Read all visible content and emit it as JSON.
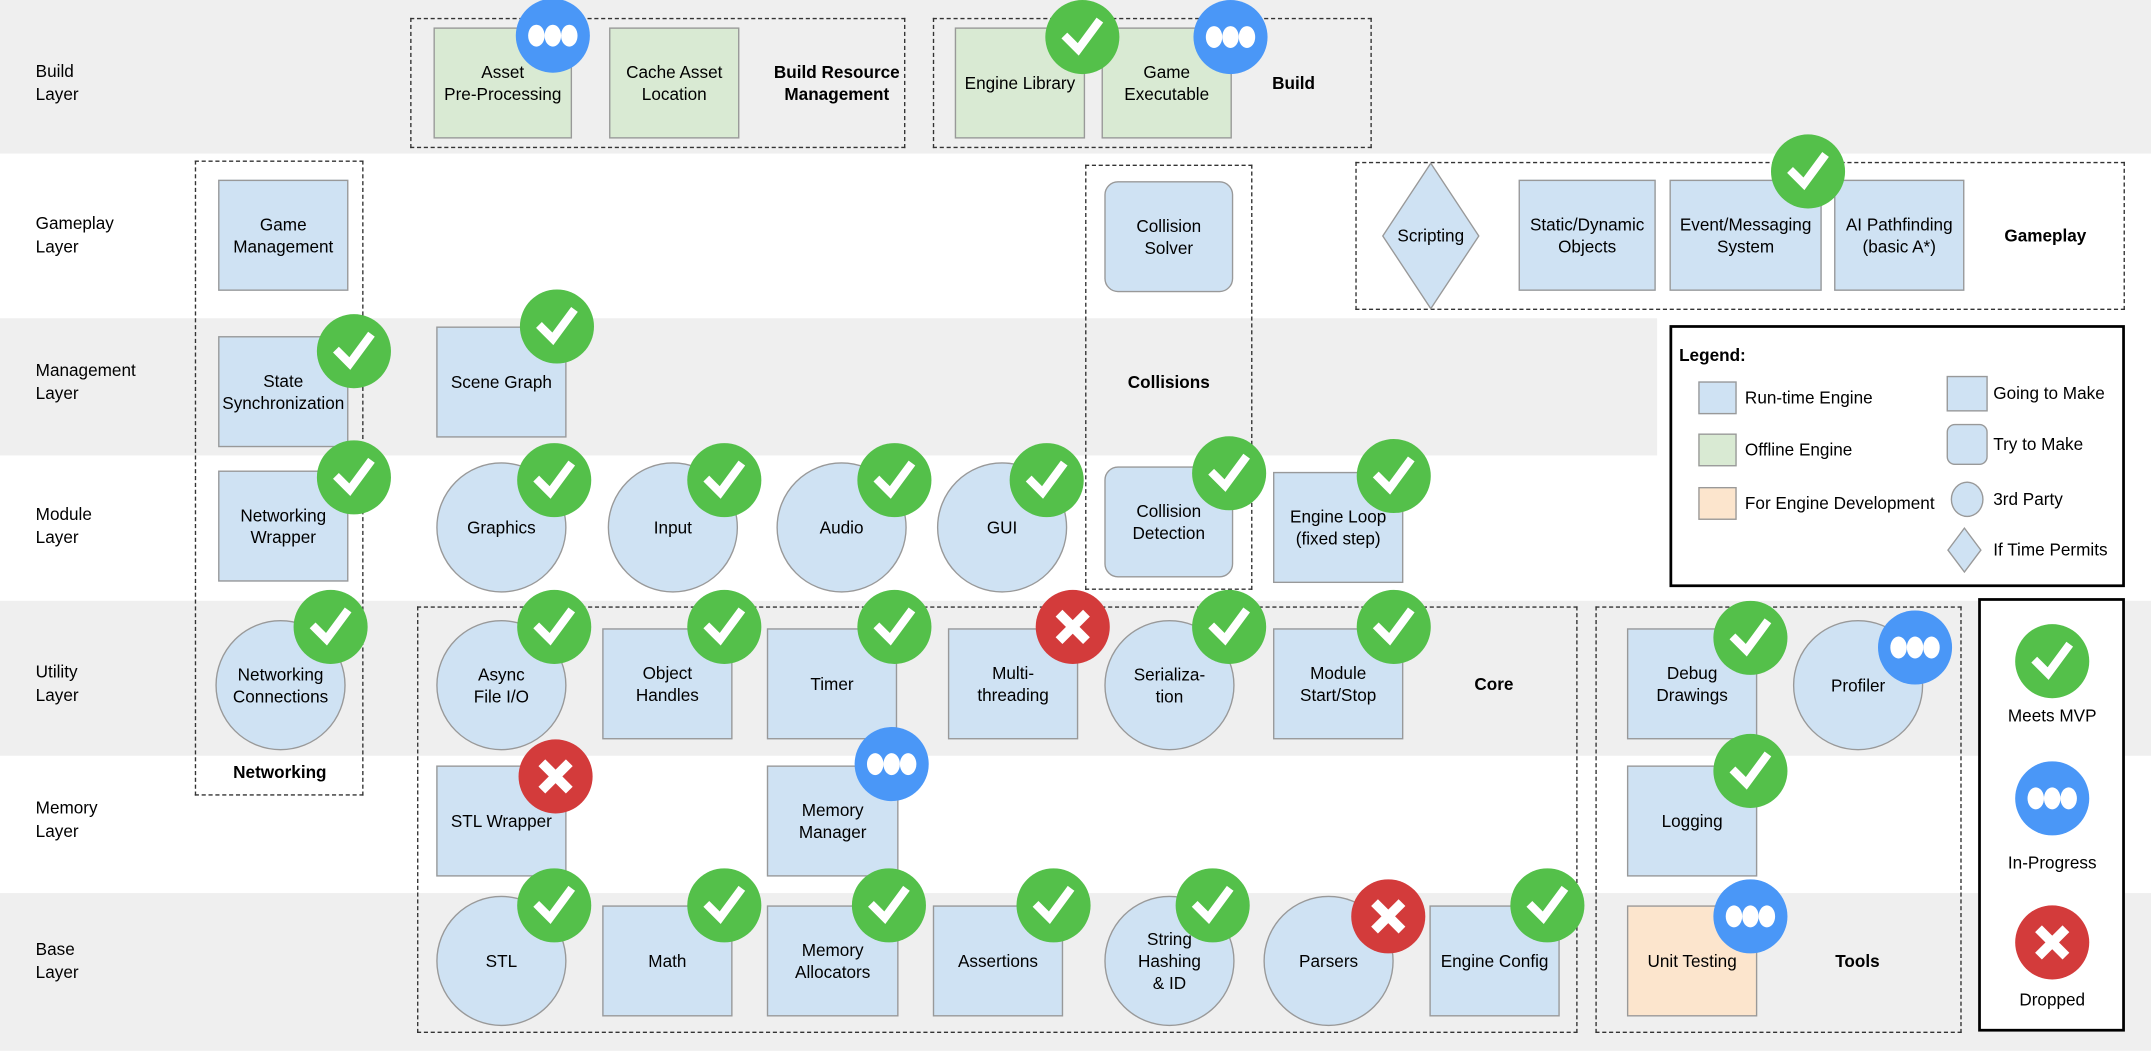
{
  "colors": {
    "runtime": "#cfe2f3",
    "offline": "#d9ead3",
    "dev": "#fce5cd",
    "done": "#54c04a",
    "in_progress": "#4a97f7",
    "dropped": "#d33b3b",
    "band": "#efefef"
  },
  "layers": [
    {
      "label": "Build\nLayer",
      "shade": true
    },
    {
      "label": "Gameplay\nLayer",
      "shade": false
    },
    {
      "label": "Management\nLayer",
      "shade": true
    },
    {
      "label": "Module\nLayer",
      "shade": false
    },
    {
      "label": "Utility\nLayer",
      "shade": true
    },
    {
      "label": "Memory\nLayer",
      "shade": false
    },
    {
      "label": "Base\nLayer",
      "shade": true
    }
  ],
  "groups": [
    {
      "label": "Build Resource\nManagement"
    },
    {
      "label": "Build"
    },
    {
      "label": "Networking"
    },
    {
      "label": "Collisions"
    },
    {
      "label": "Gameplay"
    },
    {
      "label": "Core"
    },
    {
      "label": "Tools"
    }
  ],
  "nodes": [
    {
      "label": "Asset\nPre-Processing",
      "kind": "offline",
      "shape": "square",
      "status": "in-progress"
    },
    {
      "label": "Cache Asset\nLocation",
      "kind": "offline",
      "shape": "square",
      "status": null
    },
    {
      "label": "Engine Library",
      "kind": "offline",
      "shape": "square",
      "status": "done"
    },
    {
      "label": "Game\nExecutable",
      "kind": "offline",
      "shape": "square",
      "status": "in-progress"
    },
    {
      "label": "Game\nManagement",
      "kind": "runtime",
      "shape": "square",
      "status": null
    },
    {
      "label": "Collision\nSolver",
      "kind": "runtime",
      "shape": "rounded",
      "status": null
    },
    {
      "label": "Scripting",
      "kind": "runtime",
      "shape": "diamond",
      "status": null
    },
    {
      "label": "Static/Dynamic\nObjects",
      "kind": "runtime",
      "shape": "square",
      "status": null
    },
    {
      "label": "Event/Messaging\nSystem",
      "kind": "runtime",
      "shape": "square",
      "status": "done"
    },
    {
      "label": "AI Pathfinding\n(basic A*)",
      "kind": "runtime",
      "shape": "square",
      "status": null
    },
    {
      "label": "State\nSynchronization",
      "kind": "runtime",
      "shape": "square",
      "status": "done"
    },
    {
      "label": "Scene Graph",
      "kind": "runtime",
      "shape": "square",
      "status": "done"
    },
    {
      "label": "Networking\nWrapper",
      "kind": "runtime",
      "shape": "square",
      "status": "done"
    },
    {
      "label": "Graphics",
      "kind": "runtime",
      "shape": "circle",
      "status": "done"
    },
    {
      "label": "Input",
      "kind": "runtime",
      "shape": "circle",
      "status": "done"
    },
    {
      "label": "Audio",
      "kind": "runtime",
      "shape": "circle",
      "status": "done"
    },
    {
      "label": "GUI",
      "kind": "runtime",
      "shape": "circle",
      "status": "done"
    },
    {
      "label": "Collision\nDetection",
      "kind": "runtime",
      "shape": "rounded",
      "status": "done"
    },
    {
      "label": "Engine Loop\n(fixed step)",
      "kind": "runtime",
      "shape": "square",
      "status": "done"
    },
    {
      "label": "Networking\nConnections",
      "kind": "runtime",
      "shape": "circle",
      "status": "done"
    },
    {
      "label": "Async\nFile I/O",
      "kind": "runtime",
      "shape": "circle",
      "status": "done"
    },
    {
      "label": "Object\nHandles",
      "kind": "runtime",
      "shape": "square",
      "status": "done"
    },
    {
      "label": "Timer",
      "kind": "runtime",
      "shape": "square",
      "status": "done"
    },
    {
      "label": "Multi-\nthreading",
      "kind": "runtime",
      "shape": "square",
      "status": "dropped"
    },
    {
      "label": "Serializa-\ntion",
      "kind": "runtime",
      "shape": "circle",
      "status": "done"
    },
    {
      "label": "Module\nStart/Stop",
      "kind": "runtime",
      "shape": "square",
      "status": "done"
    },
    {
      "label": "Debug\nDrawings",
      "kind": "runtime",
      "shape": "square",
      "status": "done"
    },
    {
      "label": "Profiler",
      "kind": "runtime",
      "shape": "circle",
      "status": "in-progress"
    },
    {
      "label": "STL Wrapper",
      "kind": "runtime",
      "shape": "square",
      "status": "dropped"
    },
    {
      "label": "Memory\nManager",
      "kind": "runtime",
      "shape": "square",
      "status": "in-progress"
    },
    {
      "label": "Logging",
      "kind": "runtime",
      "shape": "square",
      "status": "done"
    },
    {
      "label": "STL",
      "kind": "runtime",
      "shape": "circle",
      "status": "done"
    },
    {
      "label": "Math",
      "kind": "runtime",
      "shape": "square",
      "status": "done"
    },
    {
      "label": "Memory\nAllocators",
      "kind": "runtime",
      "shape": "square",
      "status": "done"
    },
    {
      "label": "Assertions",
      "kind": "runtime",
      "shape": "square",
      "status": "done"
    },
    {
      "label": "String\nHashing\n& ID",
      "kind": "runtime",
      "shape": "circle",
      "status": "done"
    },
    {
      "label": "Parsers",
      "kind": "runtime",
      "shape": "circle",
      "status": "dropped"
    },
    {
      "label": "Engine Config",
      "kind": "runtime",
      "shape": "square",
      "status": "done"
    },
    {
      "label": "Unit Testing",
      "kind": "dev",
      "shape": "square",
      "status": "in-progress"
    }
  ],
  "legend": {
    "title": "Legend:",
    "kinds": [
      {
        "label": "Run-time Engine",
        "kind": "runtime"
      },
      {
        "label": "Offline Engine",
        "kind": "offline"
      },
      {
        "label": "For Engine Development",
        "kind": "dev"
      }
    ],
    "shapes": [
      {
        "label": "Going to Make",
        "shape": "square"
      },
      {
        "label": "Try to Make",
        "shape": "rounded"
      },
      {
        "label": "3rd Party",
        "shape": "circle"
      },
      {
        "label": "If Time Permits",
        "shape": "diamond"
      }
    ]
  },
  "status_legend": [
    {
      "label": "Meets MVP",
      "status": "done"
    },
    {
      "label": "In-Progress",
      "status": "in-progress"
    },
    {
      "label": "Dropped",
      "status": "dropped"
    }
  ]
}
